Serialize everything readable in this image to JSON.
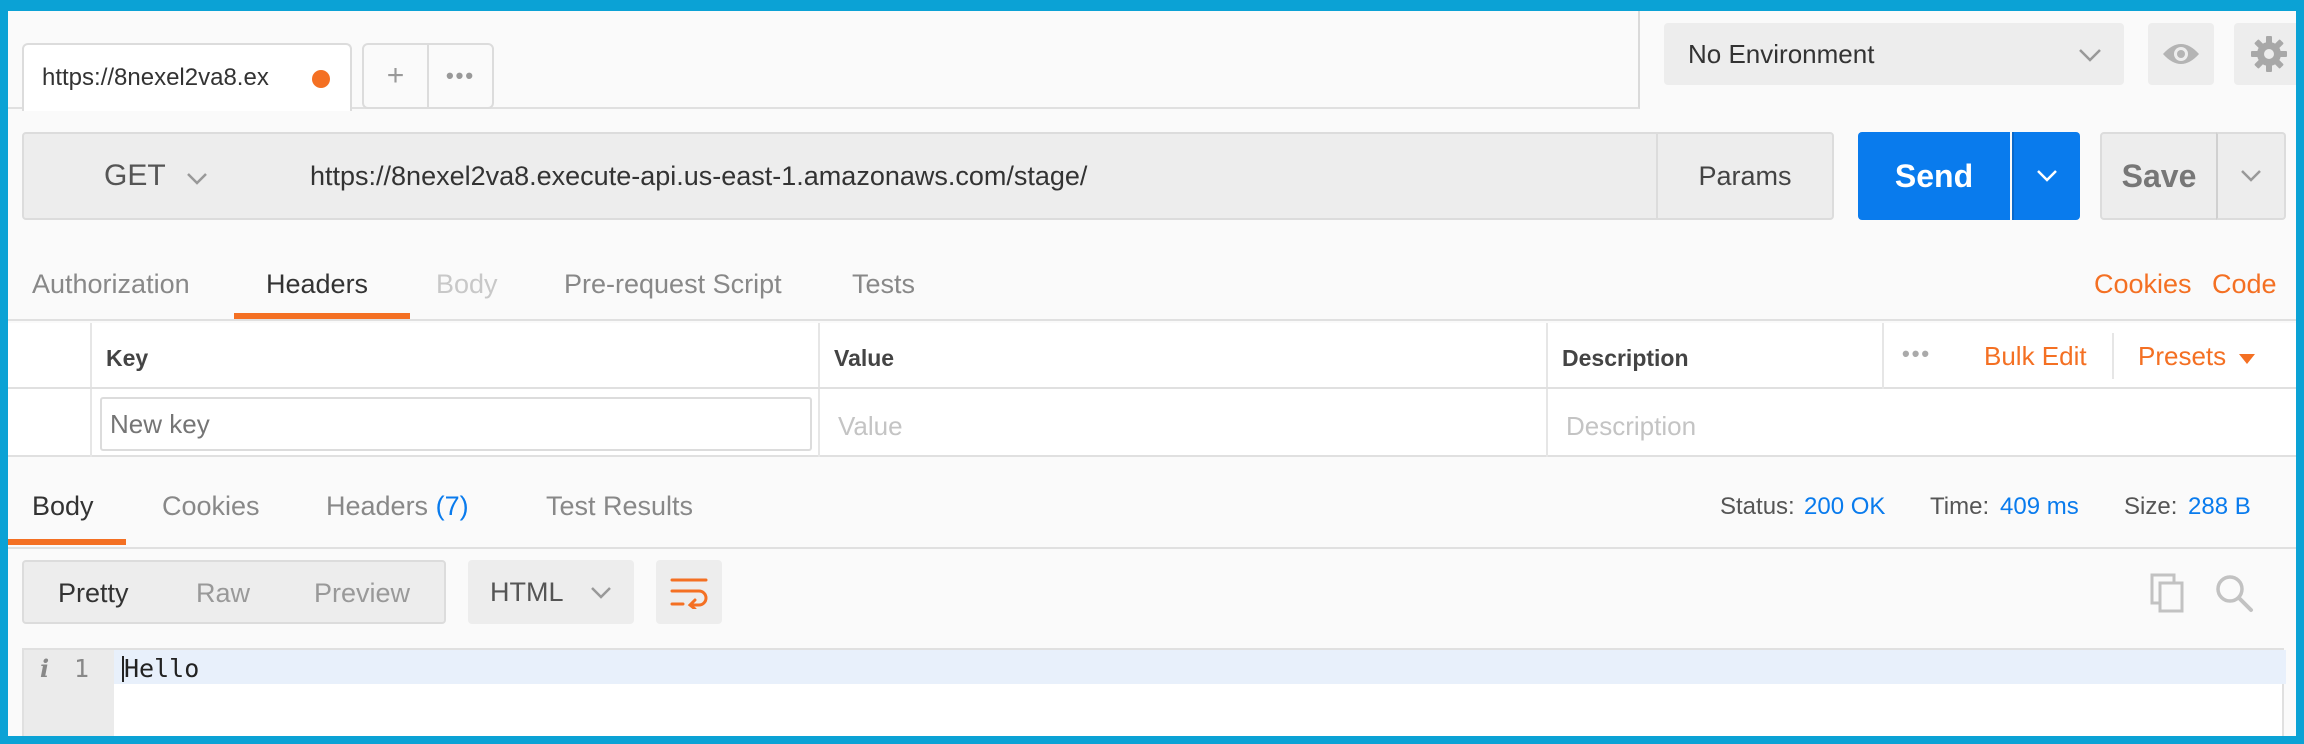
{
  "tabs": {
    "active_title": "https://8nexel2va8.ex",
    "add_label": "+",
    "more_label": "•••"
  },
  "environment": {
    "selected": "No Environment"
  },
  "request": {
    "method": "GET",
    "url": "https://8nexel2va8.execute-api.us-east-1.amazonaws.com/stage/",
    "params_label": "Params",
    "send_label": "Send",
    "save_label": "Save"
  },
  "request_tabs": {
    "items": [
      "Authorization",
      "Headers",
      "Body",
      "Pre-request Script",
      "Tests"
    ],
    "active": "Headers",
    "cookies_link": "Cookies",
    "code_link": "Code"
  },
  "headers_table": {
    "columns": [
      "Key",
      "Value",
      "Description"
    ],
    "more_label": "•••",
    "bulk_edit": "Bulk Edit",
    "presets": "Presets",
    "key_placeholder": "New key",
    "value_placeholder": "Value",
    "description_placeholder": "Description"
  },
  "response_tabs": {
    "body": "Body",
    "cookies": "Cookies",
    "headers": "Headers",
    "headers_count": "(7)",
    "test_results": "Test Results"
  },
  "response_status": {
    "status_label": "Status:",
    "status_value": "200 OK",
    "time_label": "Time:",
    "time_value": "409 ms",
    "size_label": "Size:",
    "size_value": "288 B"
  },
  "response_toolbar": {
    "views": [
      "Pretty",
      "Raw",
      "Preview"
    ],
    "active_view": "Pretty",
    "format": "HTML"
  },
  "editor": {
    "line_info": "i",
    "line_number": "1",
    "content": "Hello"
  },
  "colors": {
    "accent_orange": "#f47023",
    "send_blue": "#097bed",
    "frame_blue": "#0ba2d5"
  }
}
